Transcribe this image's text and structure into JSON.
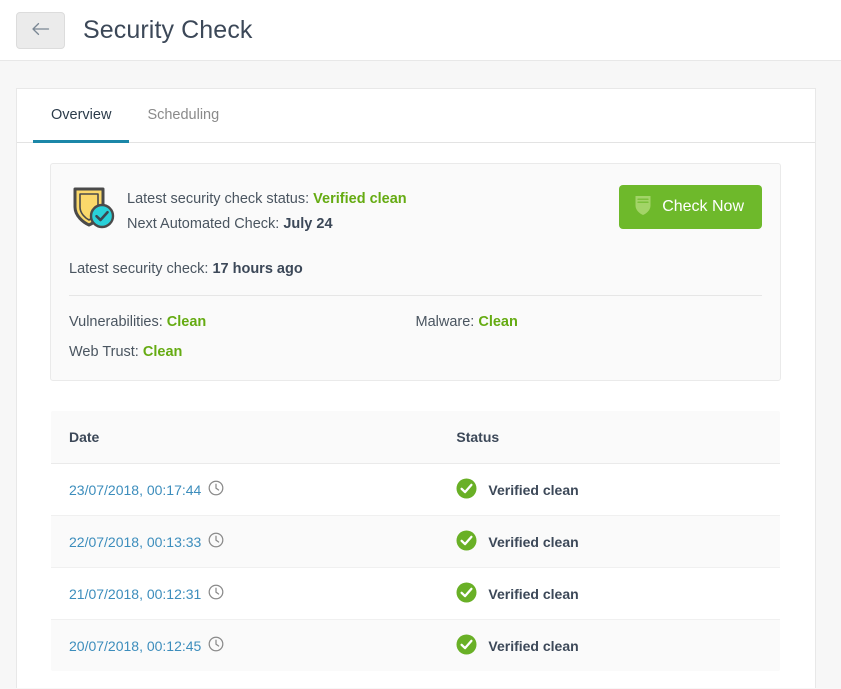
{
  "header": {
    "back_icon": "back-arrow-icon",
    "title": "Security Check"
  },
  "tabs": [
    {
      "label": "Overview",
      "active": true
    },
    {
      "label": "Scheduling",
      "active": false
    }
  ],
  "status_panel": {
    "shield_icon": "shield-check-icon",
    "latest_status_label": "Latest security check status:",
    "latest_status_value": "Verified clean",
    "next_check_label": "Next Automated Check:",
    "next_check_value": "July 24",
    "check_now_button": {
      "label": "Check Now",
      "icon": "shield-icon"
    },
    "latest_check_label": "Latest security check:",
    "latest_check_value": "17 hours ago",
    "checks": [
      {
        "label": "Vulnerabilities:",
        "value": "Clean"
      },
      {
        "label": "Malware:",
        "value": "Clean"
      },
      {
        "label": "Web Trust:",
        "value": "Clean"
      }
    ]
  },
  "history_table": {
    "columns": [
      "Date",
      "Status"
    ],
    "rows": [
      {
        "date": "23/07/2018, 00:17:44",
        "clock_icon": "clock-icon",
        "status_icon": "check-circle-icon",
        "status": "Verified clean"
      },
      {
        "date": "22/07/2018, 00:13:33",
        "clock_icon": "clock-icon",
        "status_icon": "check-circle-icon",
        "status": "Verified clean"
      },
      {
        "date": "21/07/2018, 00:12:31",
        "clock_icon": "clock-icon",
        "status_icon": "check-circle-icon",
        "status": "Verified clean"
      },
      {
        "date": "20/07/2018, 00:12:45",
        "clock_icon": "clock-icon",
        "status_icon": "check-circle-icon",
        "status": "Verified clean"
      }
    ]
  },
  "colors": {
    "tab_active_underline": "#1b87a8",
    "clean_green": "#65ab12",
    "button_green": "#6eb92b",
    "link_blue": "#3c8dbc",
    "shield_gold": "#fad961",
    "shield_badge_cyan": "#29d0d8",
    "status_check_green": "#69b026",
    "page_background": "#f7f7f7"
  }
}
